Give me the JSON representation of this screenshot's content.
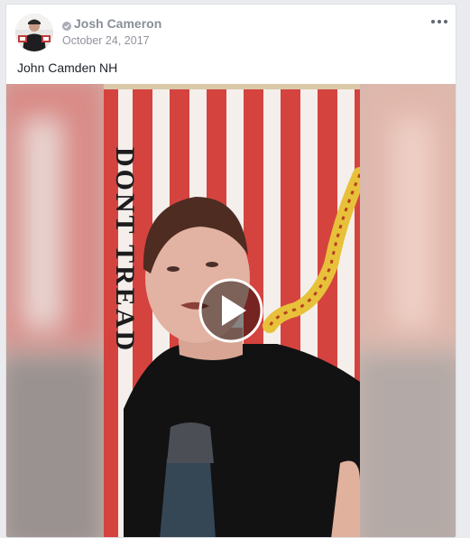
{
  "post": {
    "author": "Josh Cameron",
    "date": "October 24, 2017",
    "text": "John Camden NH",
    "verified_icon": "verified-badge-icon",
    "more_icon": "more-options-icon"
  },
  "media": {
    "type": "video",
    "play_icon": "play-icon",
    "flag_text": "DONT TREAD"
  },
  "colors": {
    "stripe_red": "#d5433f",
    "stripe_white": "#f4efeb",
    "name_gray": "#8a8f96",
    "date_gray": "#90949c",
    "text_dark": "#1d2129",
    "border": "#dddfe2"
  }
}
